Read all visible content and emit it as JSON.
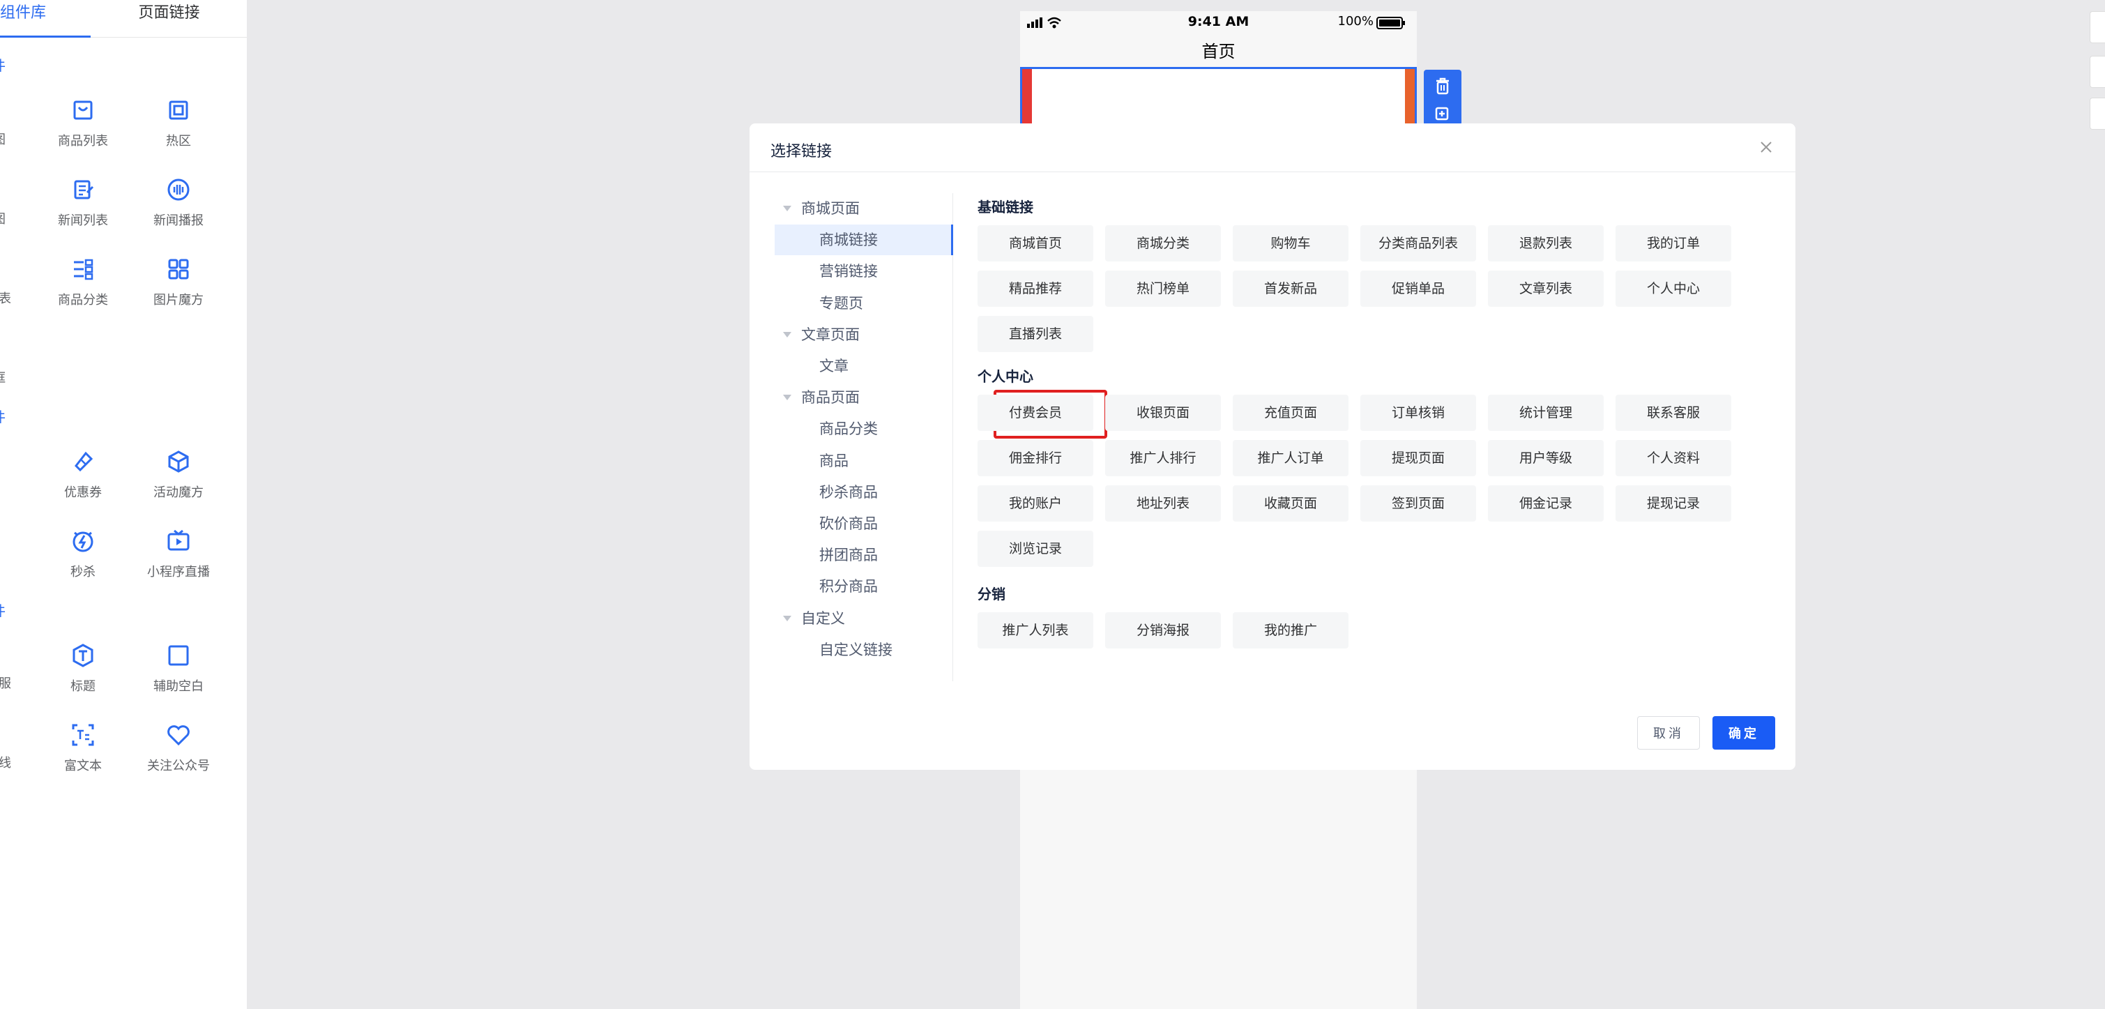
{
  "colors": {
    "accent": "#2d6cf0",
    "primary_button": "#1a5cf5",
    "highlight": "#e02020"
  },
  "left_panel": {
    "tabs": [
      {
        "label": "组件库"
      },
      {
        "label": "页面链接"
      }
    ],
    "section_glyphs": [
      "件",
      "件",
      "件"
    ],
    "cut_labels": [
      "图",
      "图",
      "表",
      "框",
      "服",
      "线"
    ],
    "items": [
      {
        "label": "商品列表",
        "icon": "goods-list-icon"
      },
      {
        "label": "热区",
        "icon": "hotspot-icon"
      },
      {
        "label": "新闻列表",
        "icon": "news-list-icon"
      },
      {
        "label": "新闻播报",
        "icon": "news-broadcast-icon"
      },
      {
        "label": "商品分类",
        "icon": "goods-category-icon"
      },
      {
        "label": "图片魔方",
        "icon": "image-cube-icon"
      },
      {
        "label": "优惠券",
        "icon": "coupon-icon"
      },
      {
        "label": "活动魔方",
        "icon": "activity-cube-icon"
      },
      {
        "label": "秒杀",
        "icon": "flash-sale-icon"
      },
      {
        "label": "小程序直播",
        "icon": "live-tv-icon"
      },
      {
        "label": "标题",
        "icon": "title-icon"
      },
      {
        "label": "辅助空白",
        "icon": "blank-space-icon"
      },
      {
        "label": "富文本",
        "icon": "rich-text-icon"
      },
      {
        "label": "关注公众号",
        "icon": "follow-heart-icon"
      }
    ]
  },
  "phone": {
    "status": {
      "time": "9:41 AM",
      "battery": "100%"
    },
    "title": "首页",
    "tools": [
      "delete-icon",
      "copy-icon"
    ]
  },
  "modal": {
    "title": "选择链接",
    "tree": [
      {
        "label": "商城页面",
        "level": 0
      },
      {
        "label": "商城链接",
        "level": 1,
        "selected": true
      },
      {
        "label": "营销链接",
        "level": 1
      },
      {
        "label": "专题页",
        "level": 1
      },
      {
        "label": "文章页面",
        "level": 0
      },
      {
        "label": "文章",
        "level": 1
      },
      {
        "label": "商品页面",
        "level": 0
      },
      {
        "label": "商品分类",
        "level": 1
      },
      {
        "label": "商品",
        "level": 1
      },
      {
        "label": "秒杀商品",
        "level": 1
      },
      {
        "label": "砍价商品",
        "level": 1
      },
      {
        "label": "拼团商品",
        "level": 1
      },
      {
        "label": "积分商品",
        "level": 1
      },
      {
        "label": "自定义",
        "level": 0
      },
      {
        "label": "自定义链接",
        "level": 1
      }
    ],
    "groups": [
      {
        "title": "基础链接",
        "links": [
          "商城首页",
          "商城分类",
          "购物车",
          "分类商品列表",
          "退款列表",
          "我的订单",
          "精品推荐",
          "热门榜单",
          "首发新品",
          "促销单品",
          "文章列表",
          "个人中心",
          "直播列表"
        ]
      },
      {
        "title": "个人中心",
        "links": [
          "付费会员",
          "收银页面",
          "充值页面",
          "订单核销",
          "统计管理",
          "联系客服",
          "佣金排行",
          "推广人排行",
          "推广人订单",
          "提现页面",
          "用户等级",
          "个人资料",
          "我的账户",
          "地址列表",
          "收藏页面",
          "签到页面",
          "佣金记录",
          "提现记录",
          "浏览记录"
        ]
      },
      {
        "title": "分销",
        "links": [
          "推广人列表",
          "分销海报",
          "我的推广"
        ]
      }
    ],
    "highlighted_link": "付费会员",
    "cancel_label": "取消",
    "ok_label": "确定"
  }
}
